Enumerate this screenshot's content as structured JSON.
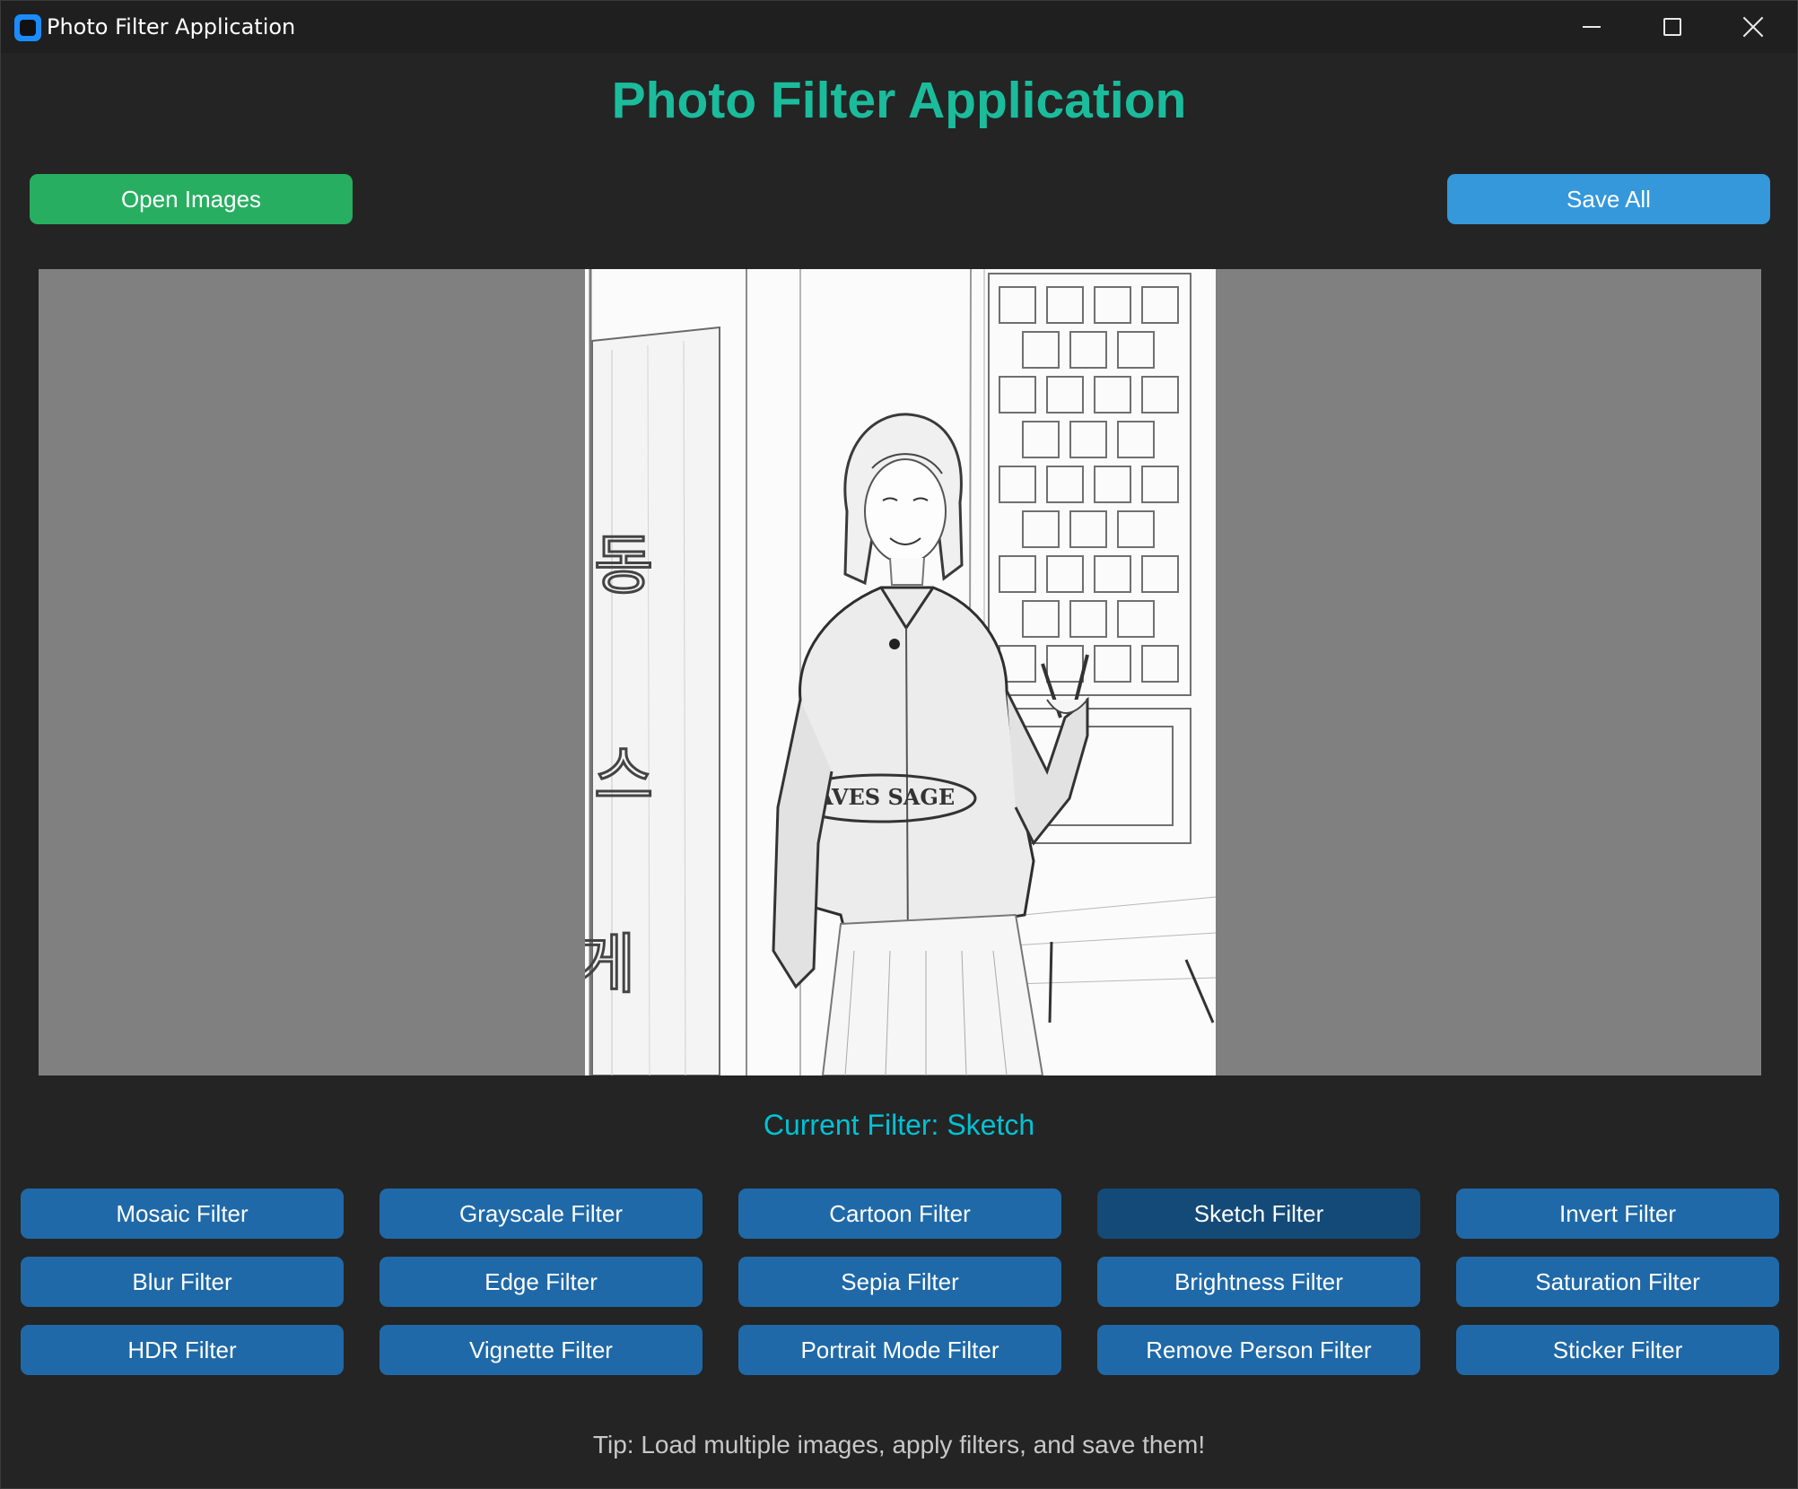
{
  "window": {
    "title": "Photo Filter Application",
    "controls": [
      "minimize",
      "maximize",
      "close"
    ]
  },
  "header": {
    "title": "Photo Filter Application"
  },
  "toolbar": {
    "open_label": "Open Images",
    "save_label": "Save All"
  },
  "preview": {
    "image_description_icon": "sketch-photo",
    "sign_text": "동 스 게",
    "jacket_text": "AVES SAGE"
  },
  "status": {
    "current_filter": "Current Filter: Sketch"
  },
  "filters": [
    {
      "label": "Mosaic Filter",
      "active": false
    },
    {
      "label": "Grayscale Filter",
      "active": false
    },
    {
      "label": "Cartoon Filter",
      "active": false
    },
    {
      "label": "Sketch Filter",
      "active": true
    },
    {
      "label": "Invert Filter",
      "active": false
    },
    {
      "label": "Blur Filter",
      "active": false
    },
    {
      "label": "Edge Filter",
      "active": false
    },
    {
      "label": "Sepia Filter",
      "active": false
    },
    {
      "label": "Brightness Filter",
      "active": false
    },
    {
      "label": "Saturation Filter",
      "active": false
    },
    {
      "label": "HDR Filter",
      "active": false
    },
    {
      "label": "Vignette Filter",
      "active": false
    },
    {
      "label": "Portrait Mode Filter",
      "active": false
    },
    {
      "label": "Remove Person Filter",
      "active": false
    },
    {
      "label": "Sticker Filter",
      "active": false
    }
  ],
  "footer": {
    "tip": "Tip: Load multiple images, apply filters, and save them!"
  },
  "colors": {
    "heading": "#1abc9c",
    "open_button": "#27ae60",
    "save_button": "#3498db",
    "filter_button": "#1f69a8",
    "filter_button_active": "#144a78",
    "current_filter_text": "#00c2d4"
  }
}
